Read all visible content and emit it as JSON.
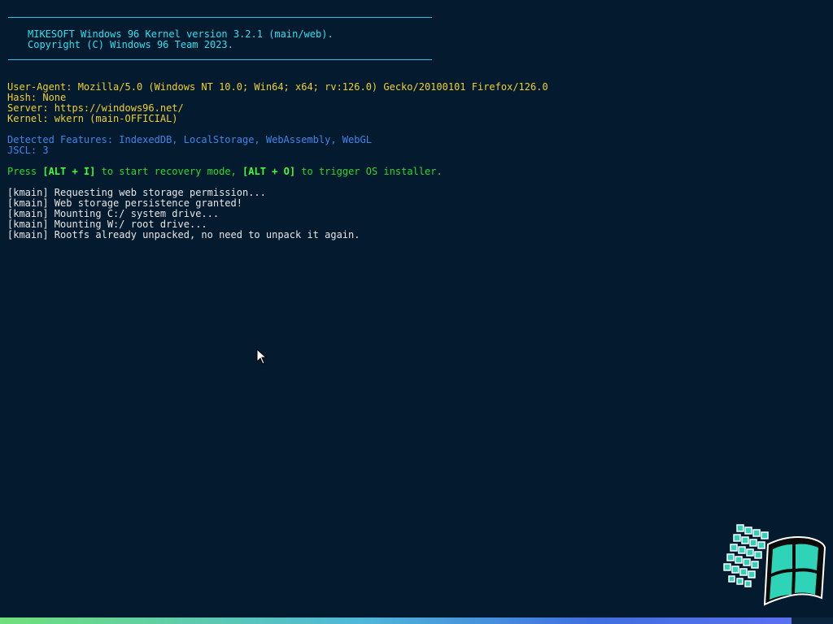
{
  "banner": {
    "line1": "MIKESOFT Windows 96 Kernel version 3.2.1 (main/web).",
    "line2": "Copyright (C) Windows 96 Team 2023."
  },
  "system_info": {
    "user_agent": "User-Agent: Mozilla/5.0 (Windows NT 10.0; Win64; x64; rv:126.0) Gecko/20100101 Firefox/126.0",
    "hash": "Hash: None",
    "server": "Server: https://windows96.net/",
    "kernel": "Kernel: wkern (main-OFFICIAL)"
  },
  "features": {
    "detected": "Detected Features: IndexedDB, LocalStorage, WebAssembly, WebGL",
    "jscl": "JSCL: 3"
  },
  "recovery_hint": {
    "press": "Press ",
    "key1": "[ALT + I]",
    "mid": " to start recovery mode, ",
    "key2": "[ALT + O]",
    "end": " to trigger OS installer."
  },
  "log": [
    "[kmain] Requesting web storage permission...",
    "[kmain] Web storage persistence granted!",
    "[kmain] Mounting C:/ system drive...",
    "[kmain] Mounting W:/ root drive...",
    "[kmain] Rootfs already unpacked, no need to unpack it again."
  ],
  "progress": {
    "fraction": 0.95
  },
  "icons": {
    "cursor": "mouse-pointer-icon",
    "logo": "windows96-logo"
  },
  "colors": {
    "background": "#041a2f",
    "banner": "#2ee0f0",
    "info": "#f0d030",
    "features": "#3f86ea",
    "hint": "#2fd72f",
    "log": "#e6e6e6"
  }
}
